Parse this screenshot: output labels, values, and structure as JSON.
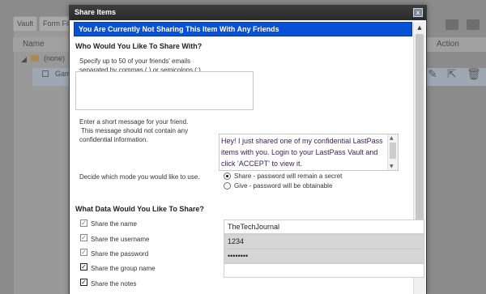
{
  "background": {
    "tabs": [
      "Vault",
      "Form Fill"
    ],
    "columns": {
      "name": "Name",
      "action": "Action"
    },
    "group_name": "(none)",
    "item_name": "Gam"
  },
  "dialog": {
    "title": "Share Items",
    "banner": "You Are Currently Not Sharing This Item With Any Friends",
    "close_label": "x",
    "section1_title": "Who Would You Like To Share With?",
    "email_instruction_line1": "Specify up to 50 of your friends' emails",
    "email_instruction_line2": "separated by commas (,) or semicolons (;)",
    "email_value": "",
    "message_instruction_line1": "Enter a short message for your friend.",
    "message_instruction_line2": "This message should not contain any",
    "message_instruction_line3": "confidential information.",
    "message_value": "Hey! I just shared one of my confidential LastPass items with you. Login to your LastPass Vault and click 'ACCEPT' to view it.",
    "mode_instruction": "Decide which mode you would like to use.",
    "mode_options": [
      {
        "label": "Share - password will remain a secret",
        "checked": true
      },
      {
        "label": "Give - password will be obtainable",
        "checked": false
      }
    ],
    "section2_title": "What Data Would You Like To Share?",
    "data_items": [
      {
        "label": "Share the name",
        "value": "TheTechJournal",
        "checked": true
      },
      {
        "label": "Share the username",
        "value": "1234",
        "checked": true
      },
      {
        "label": "Share the password",
        "value": "••••••••",
        "checked": true
      },
      {
        "label": "Share the group name",
        "value": "",
        "checked": true
      },
      {
        "label": "Share the notes",
        "value": "",
        "checked": true
      }
    ]
  },
  "colors": {
    "banner": "#0751d8",
    "titlebar": "#2f2f2f"
  }
}
